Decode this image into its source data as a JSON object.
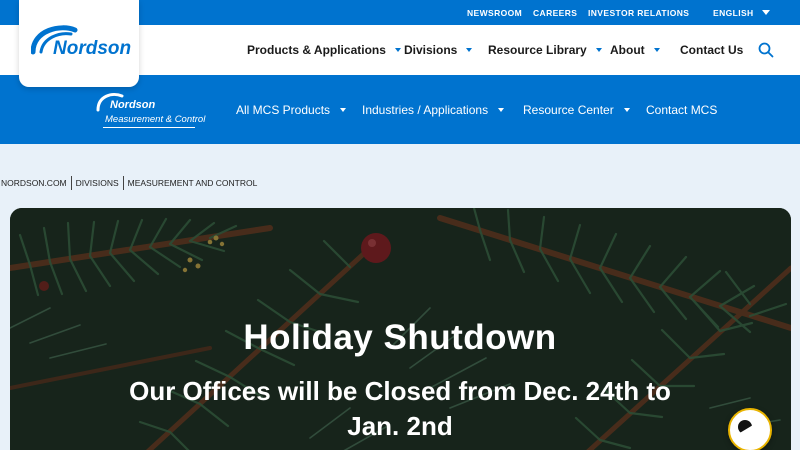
{
  "utility": {
    "links": [
      "NEWSROOM",
      "CAREERS",
      "INVESTOR RELATIONS"
    ],
    "language": "ENGLISH"
  },
  "nav": {
    "items": [
      "Products & Applications",
      "Divisions",
      "Resource Library",
      "About",
      "Contact Us"
    ]
  },
  "subnav": {
    "logo_brand": "Nordson",
    "logo_division": "Measurement & Control",
    "items": [
      "All MCS Products",
      "Industries / Applications",
      "Resource Center",
      "Contact MCS"
    ]
  },
  "breadcrumb": [
    "NORDSON.COM",
    "DIVISIONS",
    "MEASUREMENT AND CONTROL"
  ],
  "hero": {
    "title": "Holiday Shutdown",
    "subtitle": "Our Offices will be Closed from Dec. 24th to Jan. 2nd"
  },
  "logo": {
    "brand": "Nordson"
  },
  "colors": {
    "brand_blue": "#0073cf",
    "chat_ring": "#e9b400"
  },
  "icons": {
    "search": "search-icon",
    "chat": "chat-icon"
  }
}
